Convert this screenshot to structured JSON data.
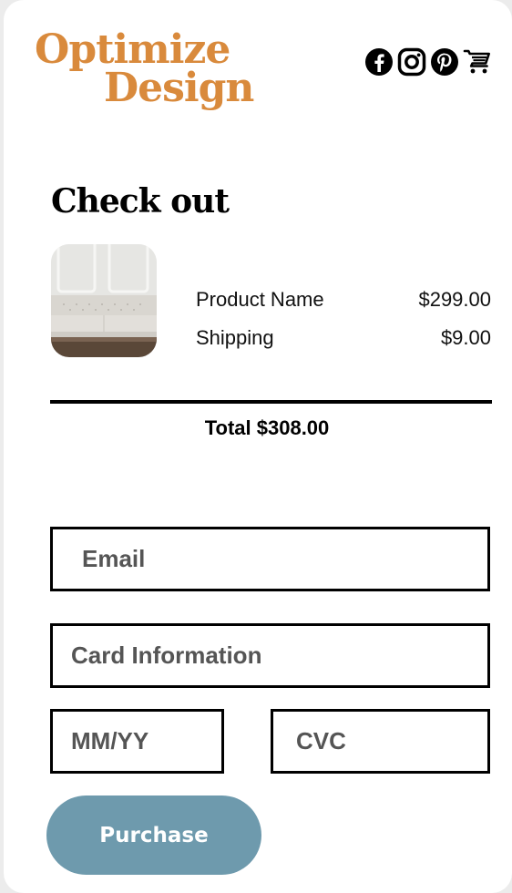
{
  "brand": {
    "line1": "Optimize",
    "line2": "Design",
    "color": "#d98a3c"
  },
  "header_icons": [
    "facebook-icon",
    "instagram-icon",
    "pinterest-icon",
    "cart-icon"
  ],
  "checkout": {
    "title": "Check out",
    "items": [
      {
        "label": "Product Name",
        "price": "$299.00"
      },
      {
        "label": "Shipping",
        "price": "$9.00"
      }
    ],
    "total": "Total $308.00"
  },
  "form": {
    "email_placeholder": "Email",
    "card_placeholder": "Card Information",
    "expiry_placeholder": "MM/YY",
    "cvc_placeholder": "CVC"
  },
  "purchase_button": {
    "label": "Purchase",
    "color": "#6e9aad"
  }
}
